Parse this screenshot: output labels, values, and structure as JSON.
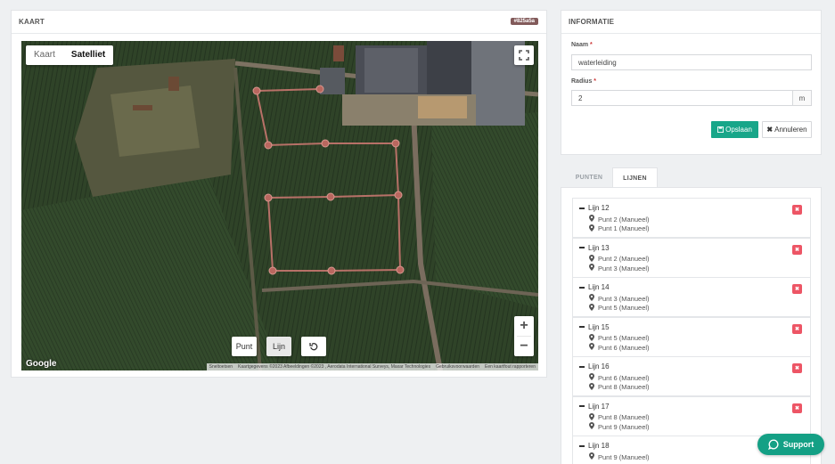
{
  "map_panel": {
    "title": "KAART",
    "color_badge": "#825a5a",
    "map_type_options": [
      "Kaart",
      "Satelliet"
    ],
    "map_type_selected": "Satelliet",
    "tools": {
      "point": "Punt",
      "line": "Lijn",
      "active": "Lijn"
    },
    "google_label": "Google",
    "attribution": [
      "Sneltoetsen",
      "Kaartgegevens ©2023 Afbeeldingen ©2023 , Aerodata International Surveys, Maxar Technologies",
      "Gebruiksvoorwaarden",
      "Een kaartfout rapporteren"
    ]
  },
  "info": {
    "title": "INFORMATIE",
    "name_label": "Naam",
    "name_value": "waterleiding",
    "radius_label": "Radius",
    "radius_value": "2",
    "radius_unit": "m",
    "save_label": "Opslaan",
    "cancel_label": "Annuleren"
  },
  "tabs": {
    "points": "PUNTEN",
    "lines": "LIJNEN",
    "active": "LIJNEN"
  },
  "lines": [
    {
      "name": "Lijn 12",
      "points": [
        "Punt 2 (Manueel)",
        "Punt 1 (Manueel)"
      ]
    },
    {
      "name": "Lijn 13",
      "points": [
        "Punt 2 (Manueel)",
        "Punt 3 (Manueel)"
      ]
    },
    {
      "name": "Lijn 14",
      "points": [
        "Punt 3 (Manueel)",
        "Punt 5 (Manueel)"
      ]
    },
    {
      "name": "Lijn 15",
      "points": [
        "Punt 5 (Manueel)",
        "Punt 6 (Manueel)"
      ]
    },
    {
      "name": "Lijn 16",
      "points": [
        "Punt 6 (Manueel)",
        "Punt 8 (Manueel)"
      ]
    },
    {
      "name": "Lijn 17",
      "points": [
        "Punt 8 (Manueel)",
        "Punt 9 (Manueel)"
      ]
    },
    {
      "name": "Lijn 18",
      "points": [
        "Punt 9 (Manueel)"
      ]
    }
  ],
  "support_label": "Support",
  "colors": {
    "accent": "#18a689",
    "danger": "#ed5565",
    "line": "#c8776f"
  },
  "icons": [
    "fullscreen-icon",
    "zoom-in-icon",
    "zoom-out-icon",
    "undo-icon",
    "save-icon",
    "close-icon",
    "map-marker-icon",
    "chat-icon"
  ]
}
